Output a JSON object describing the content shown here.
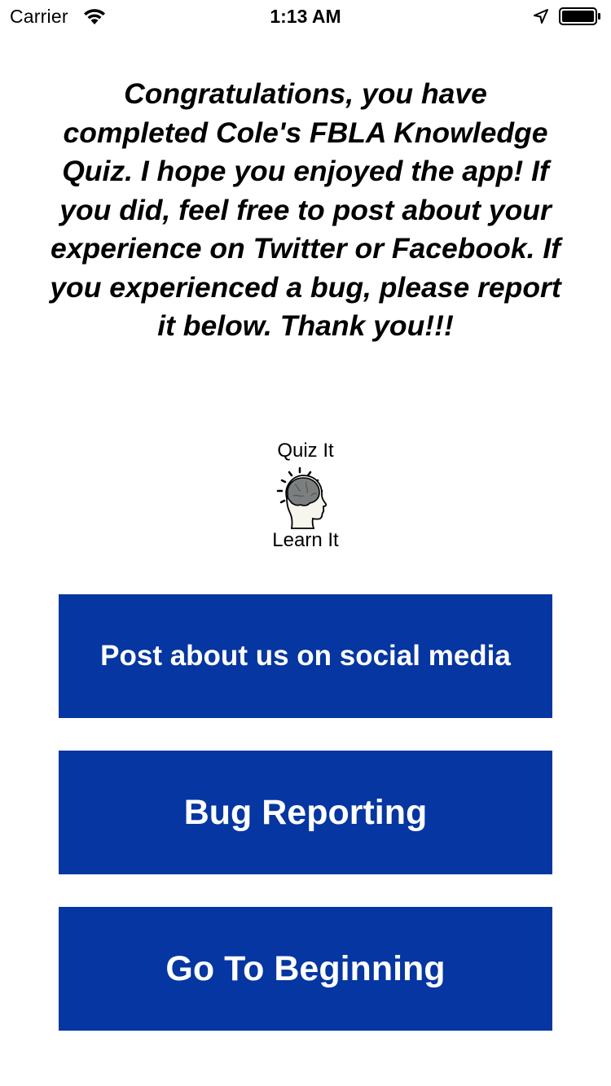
{
  "status_bar": {
    "carrier": "Carrier",
    "time": "1:13 AM",
    "icons": [
      "wifi-icon",
      "location-arrow-icon",
      "battery-icon"
    ]
  },
  "message": "Congratulations, you have completed Cole's FBLA Knowledge Quiz. I hope you enjoyed the app! If you did, feel free to post about your experience on Twitter or Facebook. If you experienced a bug, please report it below. Thank you!!!",
  "logo": {
    "top_text": "Quiz It",
    "bottom_text": "Learn It",
    "icon": "brain-head-icon"
  },
  "buttons": {
    "social": "Post about us on social media",
    "bug": "Bug Reporting",
    "beginning": "Go To Beginning"
  },
  "colors": {
    "button_background": "#0536a1",
    "button_text": "#ffffff",
    "background": "#ffffff"
  }
}
